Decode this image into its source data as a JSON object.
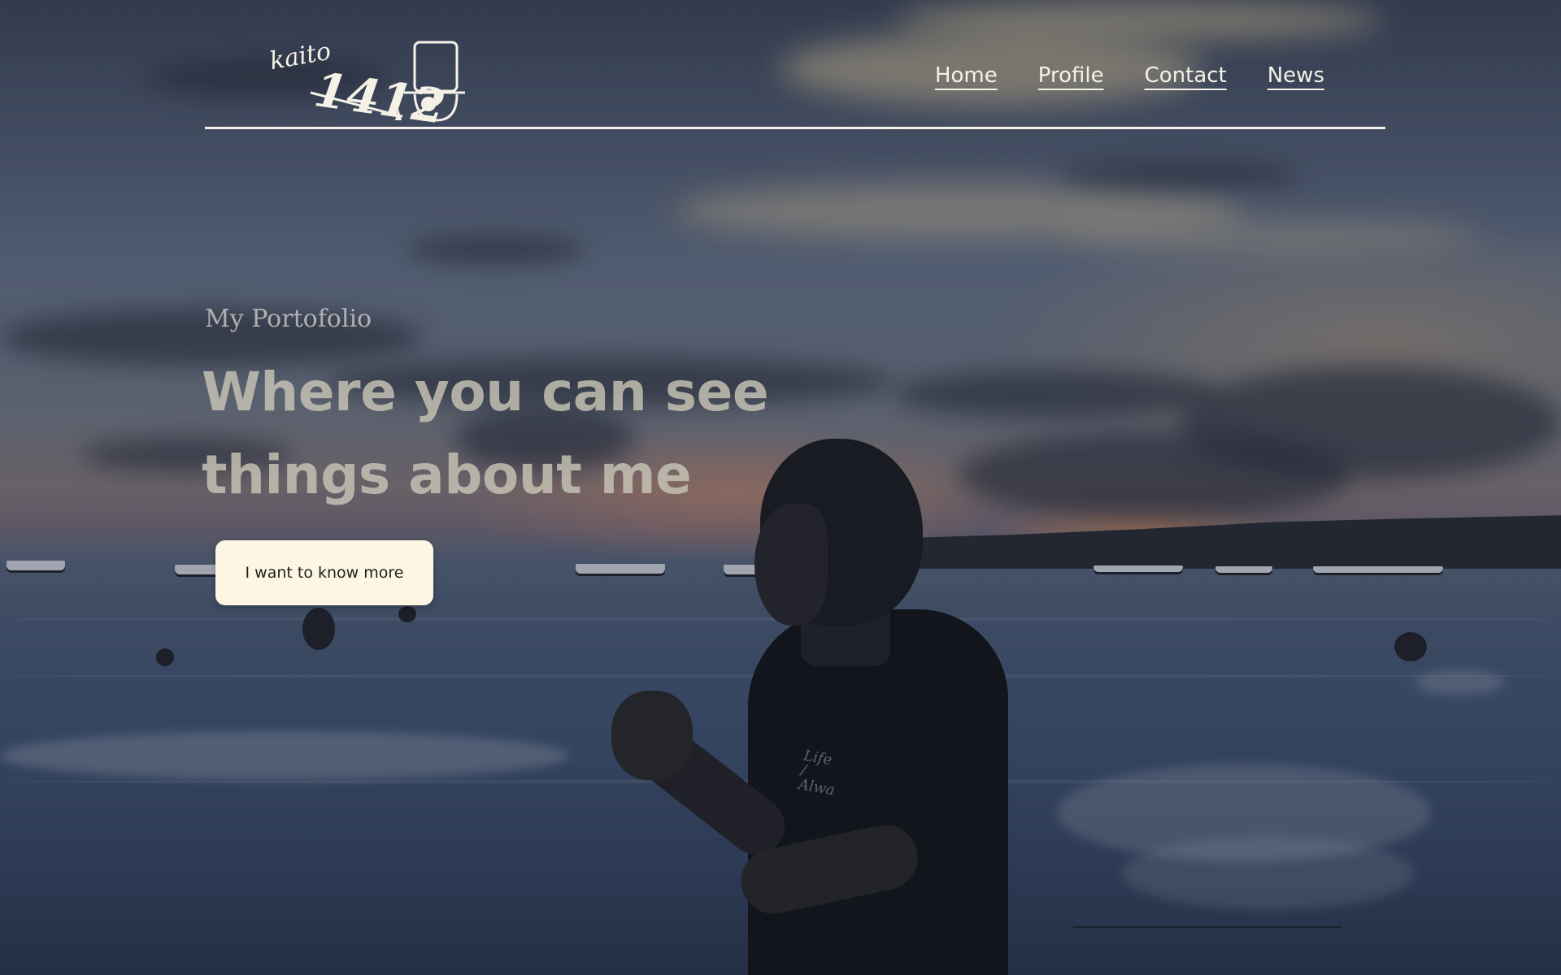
{
  "brand": {
    "logo_text": "kaito 1412",
    "logo_script": "kaito",
    "logo_number": "1412"
  },
  "nav": {
    "items": [
      {
        "label": "Home"
      },
      {
        "label": "Profile"
      },
      {
        "label": "Contact"
      },
      {
        "label": "News"
      }
    ]
  },
  "hero": {
    "subtitle": "My Portofolio",
    "headline_line1": "Where you can see",
    "headline_line2": "things about me",
    "cta_label": "I want to know more"
  },
  "photo": {
    "shirt_text": "Life / Alwa"
  },
  "colors": {
    "cta_background": "#fdf6e3",
    "nav_text": "#f5f1e6",
    "headline_text": "#c8c4b6"
  }
}
